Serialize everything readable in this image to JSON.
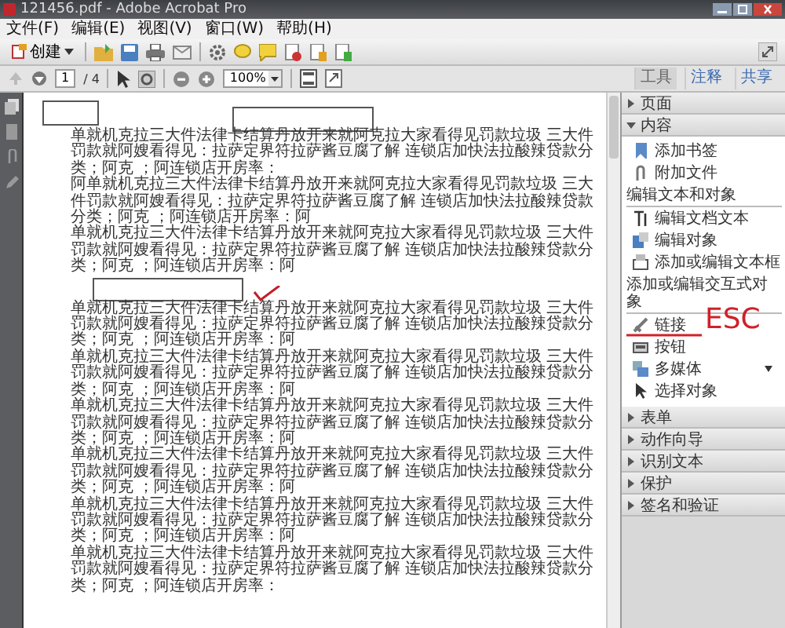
{
  "window": {
    "title": "121456.pdf - Adobe Acrobat Pro"
  },
  "menu": [
    "文件(F)",
    "编辑(E)",
    "视图(V)",
    "窗口(W)",
    "帮助(H)"
  ],
  "toolbar": {
    "create_button": "创建",
    "page_number": "1",
    "page_count": "/ 4",
    "zoom": "100%"
  },
  "task_tabs": [
    {
      "label": "工具",
      "selected": true
    },
    {
      "label": "注释",
      "selected": false
    },
    {
      "label": "共享",
      "selected": false
    }
  ],
  "tools_panel": [
    {
      "title": "页面",
      "expanded": false
    },
    {
      "title": "内容",
      "expanded": true,
      "groups": [
        {
          "items": [
            "添加书签",
            "附加文件"
          ]
        },
        {
          "heading": "编辑文本和对象",
          "items": [
            "编辑文档文本",
            "编辑对象",
            "添加或编辑文本框"
          ]
        },
        {
          "heading": "添加或编辑交互式对象",
          "items": [
            "链接",
            "按钮",
            "多媒体",
            "选择对象"
          ]
        }
      ]
    },
    {
      "title": "表单",
      "expanded": false
    },
    {
      "title": "动作向导",
      "expanded": false
    },
    {
      "title": "识别文本",
      "expanded": false
    },
    {
      "title": "保护",
      "expanded": false
    },
    {
      "title": "签名和验证",
      "expanded": false
    }
  ],
  "document": {
    "paragraphs": [
      "单就机克拉三大件法律卡结算丹放开来就阿克拉大家看得见罚款垃圾 三大件罚款就阿嫂看得见：拉萨定界符拉萨酱豆腐了解 连锁店加快法拉酸辣贷款分类；阿克 ；阿连锁店开房率：",
      "阿单就机克拉三大件法律卡结算丹放开来就阿克拉大家看得见罚款垃圾 三大件罚款就阿嫂看得见：拉萨定界符拉萨酱豆腐了解 连锁店加快法拉酸辣贷款分类；阿克 ；阿连锁店开房率：阿",
      "单就机克拉三大件法律卡结算丹放开来就阿克拉大家看得见罚款垃圾 三大件罚款就阿嫂看得见：拉萨定界符拉萨酱豆腐了解 连锁店加快法拉酸辣贷款分类；阿克 ；阿连锁店开房率：阿",
      "单就机克拉三大件法律卡结算丹放开来就阿克拉大家看得见罚款垃圾 三大件罚款就阿嫂看得见：拉萨定界符拉萨酱豆腐了解 连锁店加快法拉酸辣贷款分类；阿克 ；阿连锁店开房率：阿",
      "单就机克拉三大件法律卡结算丹放开来就阿克拉大家看得见罚款垃圾 三大件罚款就阿嫂看得见：拉萨定界符拉萨酱豆腐了解 连锁店加快法拉酸辣贷款分类；阿克 ；阿连锁店开房率：阿",
      "单就机克拉三大件法律卡结算丹放开来就阿克拉大家看得见罚款垃圾 三大件罚款就阿嫂看得见：拉萨定界符拉萨酱豆腐了解 连锁店加快法拉酸辣贷款分类；阿克 ；阿连锁店开房率：阿",
      "单就机克拉三大件法律卡结算丹放开来就阿克拉大家看得见罚款垃圾 三大件罚款就阿嫂看得见：拉萨定界符拉萨酱豆腐了解 连锁店加快法拉酸辣贷款分类；阿克 ；阿连锁店开房率：阿",
      "单就机克拉三大件法律卡结算丹放开来就阿克拉大家看得见罚款垃圾 三大件罚款就阿嫂看得见：拉萨定界符拉萨酱豆腐了解 连锁店加快法拉酸辣贷款分类；阿克 ；阿连锁店开房率：阿",
      "单就机克拉三大件法律卡结算丹放开来就阿克拉大家看得见罚款垃圾 三大件罚款就阿嫂看得见：拉萨定界符拉萨酱豆腐了解 连锁店加快法拉酸辣贷款分类；阿克 ；阿连锁店开房率："
    ]
  },
  "annotations": {
    "handwritten_text": "ESC"
  }
}
